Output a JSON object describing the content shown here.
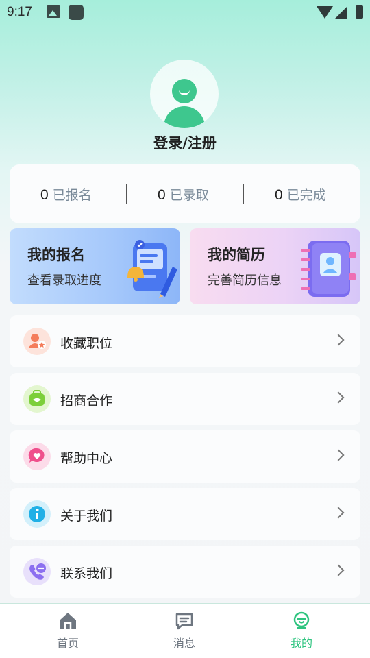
{
  "status_bar": {
    "time": "9:17"
  },
  "profile": {
    "login_label": "登录/注册"
  },
  "stats": [
    {
      "count": "0",
      "label": "已报名"
    },
    {
      "count": "0",
      "label": "已录取"
    },
    {
      "count": "0",
      "label": "已完成"
    }
  ],
  "features": {
    "signup": {
      "title": "我的报名",
      "subtitle": "查看录取进度"
    },
    "resume": {
      "title": "我的简历",
      "subtitle": "完善简历信息"
    }
  },
  "menu": [
    {
      "label": "收藏职位",
      "icon": "favorite-job-icon",
      "color": "#f47c5a"
    },
    {
      "label": "招商合作",
      "icon": "business-cooperation-icon",
      "color": "#7ccf3a"
    },
    {
      "label": "帮助中心",
      "icon": "help-center-icon",
      "color": "#ef4f8c"
    },
    {
      "label": "关于我们",
      "icon": "about-info-icon",
      "color": "#21b0e6"
    },
    {
      "label": "联系我们",
      "icon": "contact-phone-icon",
      "color": "#8c6ff0"
    }
  ],
  "bottom_nav": [
    {
      "label": "首页",
      "icon": "home-icon"
    },
    {
      "label": "消息",
      "icon": "message-icon"
    },
    {
      "label": "我的",
      "icon": "profile-icon",
      "active": true
    }
  ],
  "colors": {
    "accent": "#2ec47f",
    "avatar": "#3ec78e"
  }
}
